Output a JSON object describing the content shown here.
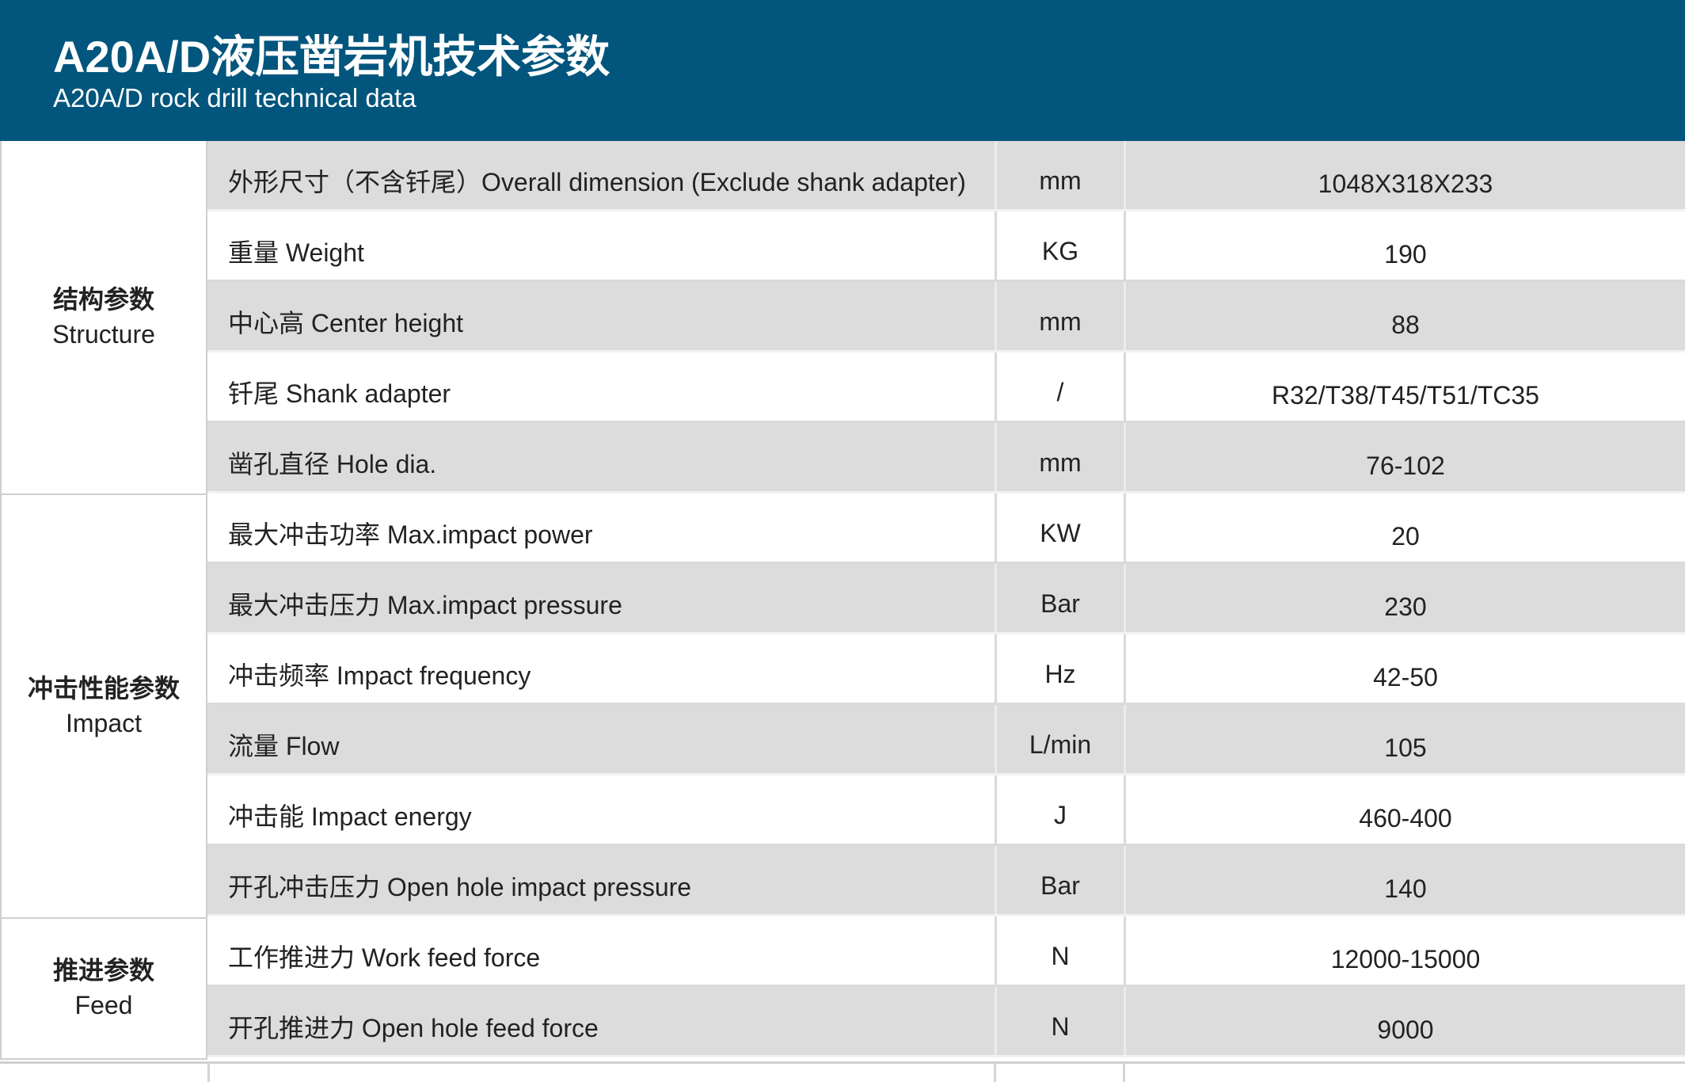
{
  "header": {
    "title_cn": "A20A/D液压凿岩机技术参数",
    "title_en": "A20A/D rock drill technical data"
  },
  "groups": [
    {
      "cn": "结构参数",
      "en": "Structure"
    },
    {
      "cn": "冲击性能参数",
      "en": "Impact"
    },
    {
      "cn": "推进参数",
      "en": "Feed"
    }
  ],
  "rows": [
    {
      "param": "外形尺寸（不含钎尾）Overall dimension (Exclude shank adapter)",
      "unit": "mm",
      "value": "1048X318X233"
    },
    {
      "param": "重量 Weight",
      "unit": "KG",
      "value": "190"
    },
    {
      "param": "中心高 Center height",
      "unit": "mm",
      "value": "88"
    },
    {
      "param": "钎尾 Shank adapter",
      "unit": "/",
      "value": "R32/T38/T45/T51/TC35"
    },
    {
      "param": "凿孔直径 Hole dia.",
      "unit": "mm",
      "value": "76-102"
    },
    {
      "param": "最大冲击功率 Max.impact power",
      "unit": "KW",
      "value": "20"
    },
    {
      "param": "最大冲击压力 Max.impact pressure",
      "unit": "Bar",
      "value": "230"
    },
    {
      "param": "冲击频率 Impact frequency",
      "unit": "Hz",
      "value": "42-50"
    },
    {
      "param": "流量 Flow",
      "unit": "L/min",
      "value": "105"
    },
    {
      "param": "冲击能 Impact energy",
      "unit": "J",
      "value": "460-400"
    },
    {
      "param": "开孔冲击压力 Open hole impact pressure",
      "unit": "Bar",
      "value": "140"
    },
    {
      "param": "工作推进力 Work feed force",
      "unit": "N",
      "value": "12000-15000"
    },
    {
      "param": "开孔推进力 Open hole feed force",
      "unit": "N",
      "value": "9000"
    }
  ]
}
